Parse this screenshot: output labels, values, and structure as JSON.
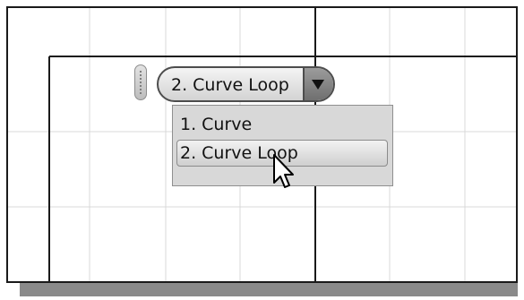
{
  "combo": {
    "selected_value": "2. Curve Loop",
    "arrow_icon": "chevron-down-icon"
  },
  "dropdown": {
    "options": [
      {
        "label": "1. Curve",
        "highlighted": false
      },
      {
        "label": "2. Curve Loop",
        "highlighted": true
      }
    ]
  },
  "cursor": {
    "icon": "arrow-cursor-icon"
  },
  "colors": {
    "grid_line": "#d9d9d9",
    "frame_line": "#1a1a1a",
    "dropdown_bg": "#d8d8d8",
    "shadow": "#8a8a8a"
  }
}
